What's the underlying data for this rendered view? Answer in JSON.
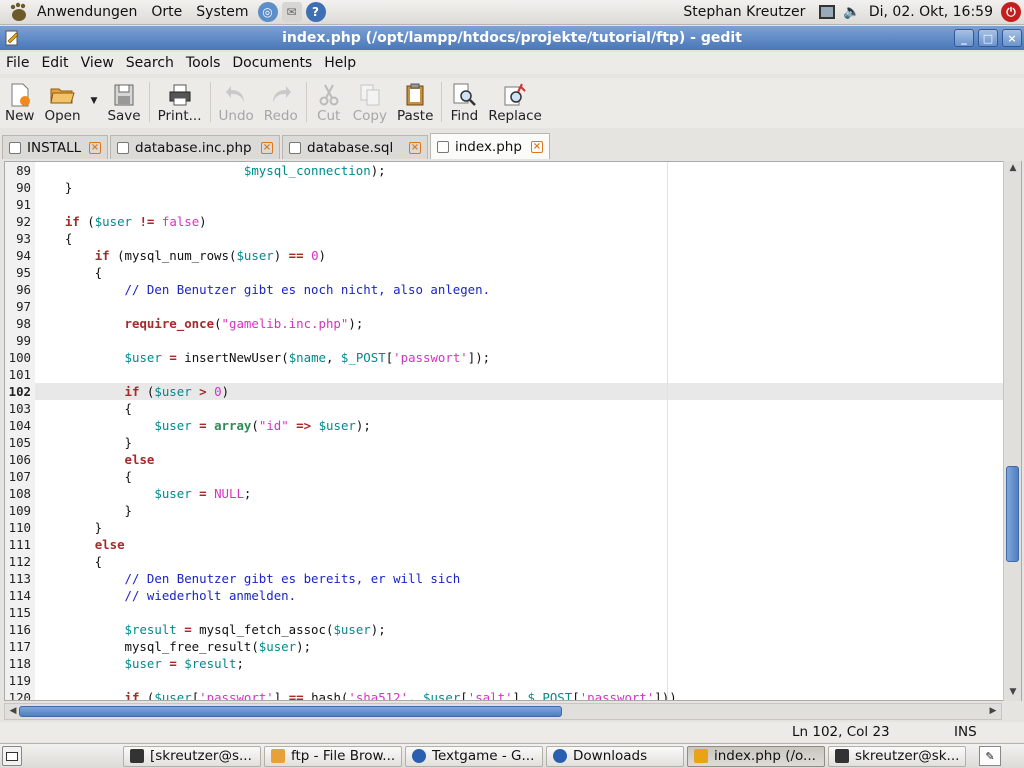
{
  "panel": {
    "menus": [
      "Anwendungen",
      "Orte",
      "System"
    ],
    "user": "Stephan Kreutzer",
    "clock": "Di, 02. Okt, 16:59"
  },
  "window": {
    "title": "index.php (/opt/lampp/htdocs/projekte/tutorial/ftp) - gedit",
    "minimize": "_",
    "maximize": "□",
    "close": "×"
  },
  "menubar": {
    "file": "File",
    "edit": "Edit",
    "view": "View",
    "search": "Search",
    "tools": "Tools",
    "documents": "Documents",
    "help": "Help"
  },
  "toolbar": {
    "new": "New",
    "open": "Open",
    "save": "Save",
    "print": "Print...",
    "undo": "Undo",
    "redo": "Redo",
    "cut": "Cut",
    "copy": "Copy",
    "paste": "Paste",
    "find": "Find",
    "replace": "Replace"
  },
  "tabs": [
    {
      "label": "INSTALL",
      "active": false
    },
    {
      "label": "database.inc.php",
      "active": false
    },
    {
      "label": "database.sql",
      "active": false
    },
    {
      "label": "index.php",
      "active": true
    }
  ],
  "code_lines": [
    {
      "n": "89",
      "html": "                            <span class=\"var\">$mysql_connection</span>);"
    },
    {
      "n": "90",
      "html": "    }"
    },
    {
      "n": "91",
      "html": ""
    },
    {
      "n": "92",
      "html": "    <span class=\"kw\">if</span> (<span class=\"var\">$user</span> <span class=\"kw\">!=</span> <span class=\"num\">false</span>)"
    },
    {
      "n": "93",
      "html": "    {"
    },
    {
      "n": "94",
      "html": "        <span class=\"kw\">if</span> (mysql_num_rows(<span class=\"var\">$user</span>) <span class=\"kw\">==</span> <span class=\"num\">0</span>)"
    },
    {
      "n": "95",
      "html": "        {"
    },
    {
      "n": "96",
      "html": "            <span class=\"cmt\">// Den Benutzer gibt es noch nicht, also anlegen.</span>"
    },
    {
      "n": "97",
      "html": ""
    },
    {
      "n": "98",
      "html": "            <span class=\"kw\">require_once</span>(<span class=\"str\">\"gamelib.inc.php\"</span>);"
    },
    {
      "n": "99",
      "html": ""
    },
    {
      "n": "100",
      "html": "            <span class=\"var\">$user</span> <span class=\"kw\">=</span> insertNewUser(<span class=\"var\">$name</span>, <span class=\"var\">$_POST</span>[<span class=\"str\">'passwort'</span>]);"
    },
    {
      "n": "101",
      "html": ""
    },
    {
      "n": "102",
      "html": "            <span class=\"kw\">if</span> (<span class=\"var\">$user</span> <span class=\"kw\">&gt;</span> <span class=\"num\">0</span>)",
      "cur": true
    },
    {
      "n": "103",
      "html": "            {"
    },
    {
      "n": "104",
      "html": "                <span class=\"var\">$user</span> <span class=\"kw\">=</span> <span class=\"fn\">array</span>(<span class=\"str\">\"id\"</span> <span class=\"kw\">=&gt;</span> <span class=\"var\">$user</span>);"
    },
    {
      "n": "105",
      "html": "            }"
    },
    {
      "n": "106",
      "html": "            <span class=\"kw\">else</span>"
    },
    {
      "n": "107",
      "html": "            {"
    },
    {
      "n": "108",
      "html": "                <span class=\"var\">$user</span> <span class=\"kw\">=</span> <span class=\"num\">NULL</span>;"
    },
    {
      "n": "109",
      "html": "            }"
    },
    {
      "n": "110",
      "html": "        }"
    },
    {
      "n": "111",
      "html": "        <span class=\"kw\">else</span>"
    },
    {
      "n": "112",
      "html": "        {"
    },
    {
      "n": "113",
      "html": "            <span class=\"cmt\">// Den Benutzer gibt es bereits, er will sich</span>"
    },
    {
      "n": "114",
      "html": "            <span class=\"cmt\">// wiederholt anmelden.</span>"
    },
    {
      "n": "115",
      "html": ""
    },
    {
      "n": "116",
      "html": "            <span class=\"var\">$result</span> <span class=\"kw\">=</span> mysql_fetch_assoc(<span class=\"var\">$user</span>);"
    },
    {
      "n": "117",
      "html": "            mysql_free_result(<span class=\"var\">$user</span>);"
    },
    {
      "n": "118",
      "html": "            <span class=\"var\">$user</span> <span class=\"kw\">=</span> <span class=\"var\">$result</span>;"
    },
    {
      "n": "119",
      "html": ""
    },
    {
      "n": "120",
      "html": "            <span class=\"kw\">if</span> (<span class=\"var\">$user</span>[<span class=\"str\">'passwort'</span>] <span class=\"kw\">==</span> hash(<span class=\"str\">'sha512'</span>, <span class=\"var\">$user</span>[<span class=\"str\">'salt'</span>].<span class=\"var\">$_POST</span>[<span class=\"str\">'passwort'</span>]))"
    }
  ],
  "status": {
    "position": "Ln 102, Col 23",
    "mode": "INS"
  },
  "taskbar": [
    {
      "label": "[skreutzer@s...",
      "icon": "terminal-icon"
    },
    {
      "label": "ftp - File Brow...",
      "icon": "folder-icon"
    },
    {
      "label": "Textgame - G...",
      "icon": "browser-icon"
    },
    {
      "label": "Downloads",
      "icon": "browser-icon"
    },
    {
      "label": "index.php (/o...",
      "icon": "gedit-icon",
      "active": true
    },
    {
      "label": "skreutzer@sk...",
      "icon": "terminal-icon"
    }
  ],
  "scroll": {
    "vertical_fraction": 0.52,
    "horizontal_fraction": 0.56
  }
}
